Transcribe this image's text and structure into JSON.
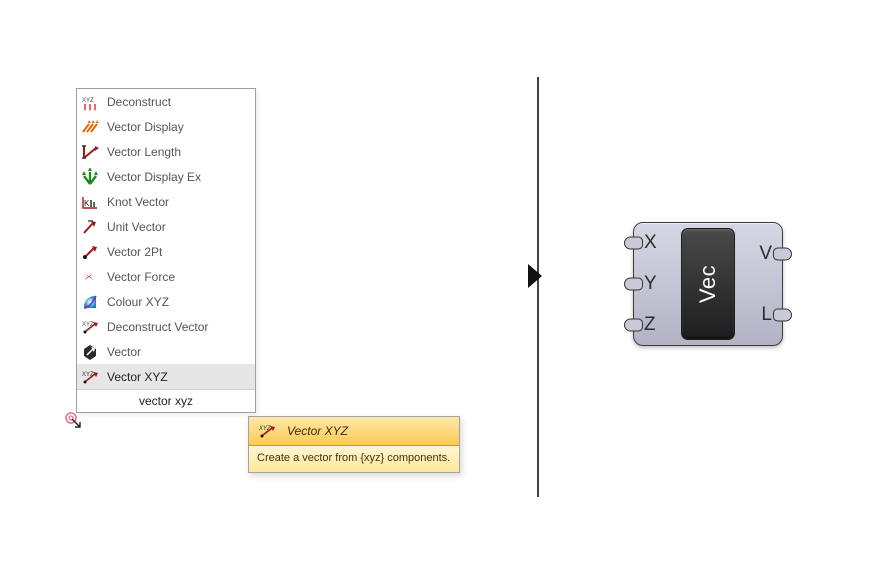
{
  "menu": {
    "items": [
      {
        "label": "Deconstruct",
        "icon": "deconstruct-icon"
      },
      {
        "label": "Vector Display",
        "icon": "vector-display-icon"
      },
      {
        "label": "Vector Length",
        "icon": "vector-length-icon"
      },
      {
        "label": "Vector Display Ex",
        "icon": "vector-display-ex-icon"
      },
      {
        "label": "Knot Vector",
        "icon": "knot-vector-icon"
      },
      {
        "label": "Unit Vector",
        "icon": "unit-vector-icon"
      },
      {
        "label": "Vector 2Pt",
        "icon": "vector-2pt-icon"
      },
      {
        "label": "Vector Force",
        "icon": "vector-force-icon"
      },
      {
        "label": "Colour XYZ",
        "icon": "colour-xyz-icon"
      },
      {
        "label": "Deconstruct Vector",
        "icon": "deconstruct-vector-icon"
      },
      {
        "label": "Vector",
        "icon": "vector-icon"
      },
      {
        "label": "Vector XYZ",
        "icon": "vector-xyz-icon"
      }
    ],
    "selected_index": 11,
    "search_value": "vector xyz"
  },
  "tooltip": {
    "title": "Vector XYZ",
    "description": "Create a vector from {xyz} components."
  },
  "component": {
    "name": "Vec",
    "inputs": [
      "X",
      "Y",
      "Z"
    ],
    "outputs": [
      "V",
      "L"
    ]
  }
}
